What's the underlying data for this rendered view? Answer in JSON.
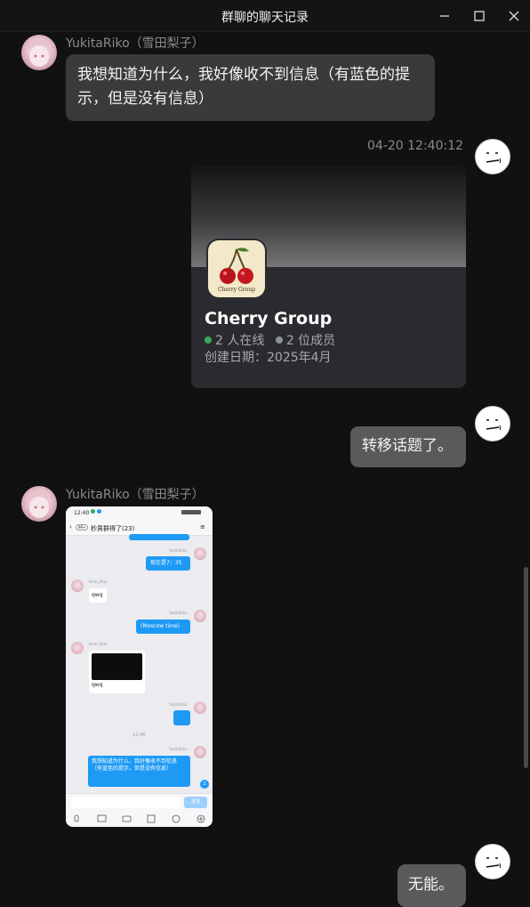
{
  "window": {
    "title": "群聊的聊天记录",
    "min_icon": "minimize-icon",
    "max_icon": "maximize-icon",
    "close_icon": "close-icon"
  },
  "messages": {
    "m1": {
      "sender": "YukitaRiko（雪田梨子）",
      "line1": "我想知道为什么，我好像收不到信息（有蓝色的提",
      "line2": "示，但是没有信息）"
    },
    "m2": {
      "timestamp": "04-20 12:40:12",
      "card": {
        "title": "Cherry Group",
        "online": "2 人在线",
        "members": "2 位成员",
        "created": "创建日期：2025年4月",
        "logo_text": "Cherry Group",
        "online_color": "#3ba55d",
        "members_color": "#8e9297"
      }
    },
    "m3": {
      "text": "转移话题了。"
    },
    "m4": {
      "sender": "YukitaRiko（雪田梨子）",
      "phone": {
        "status_time": "12:40",
        "group_title": "秒男群得了(23)",
        "back_badge": "99+",
        "msgs": {
          "a_name": "YukitaRiko",
          "a_text": "现在是7：35",
          "b_name": "Kesh_Shol.",
          "b_text": "qwq",
          "c_name": "YukitaRiko",
          "c_text": "(Moscow time)",
          "d_name": "Kesh_Shol.",
          "d_text": "qwq",
          "e_name": "YukitaRiko",
          "time": "12:40",
          "f_name": "YukitaRiko",
          "f_text": "我想知道为什么，我好像收不到信息（有蓝色的提示，但是没有信息）",
          "unread": "2"
        },
        "send_label": "发送"
      }
    },
    "m5": {
      "text": "无能。"
    }
  },
  "colors": {
    "background": "#111111",
    "bubble_left": "#3a3a3a",
    "bubble_right": "#5a5a5a",
    "qq_blue": "#1e9af5"
  }
}
